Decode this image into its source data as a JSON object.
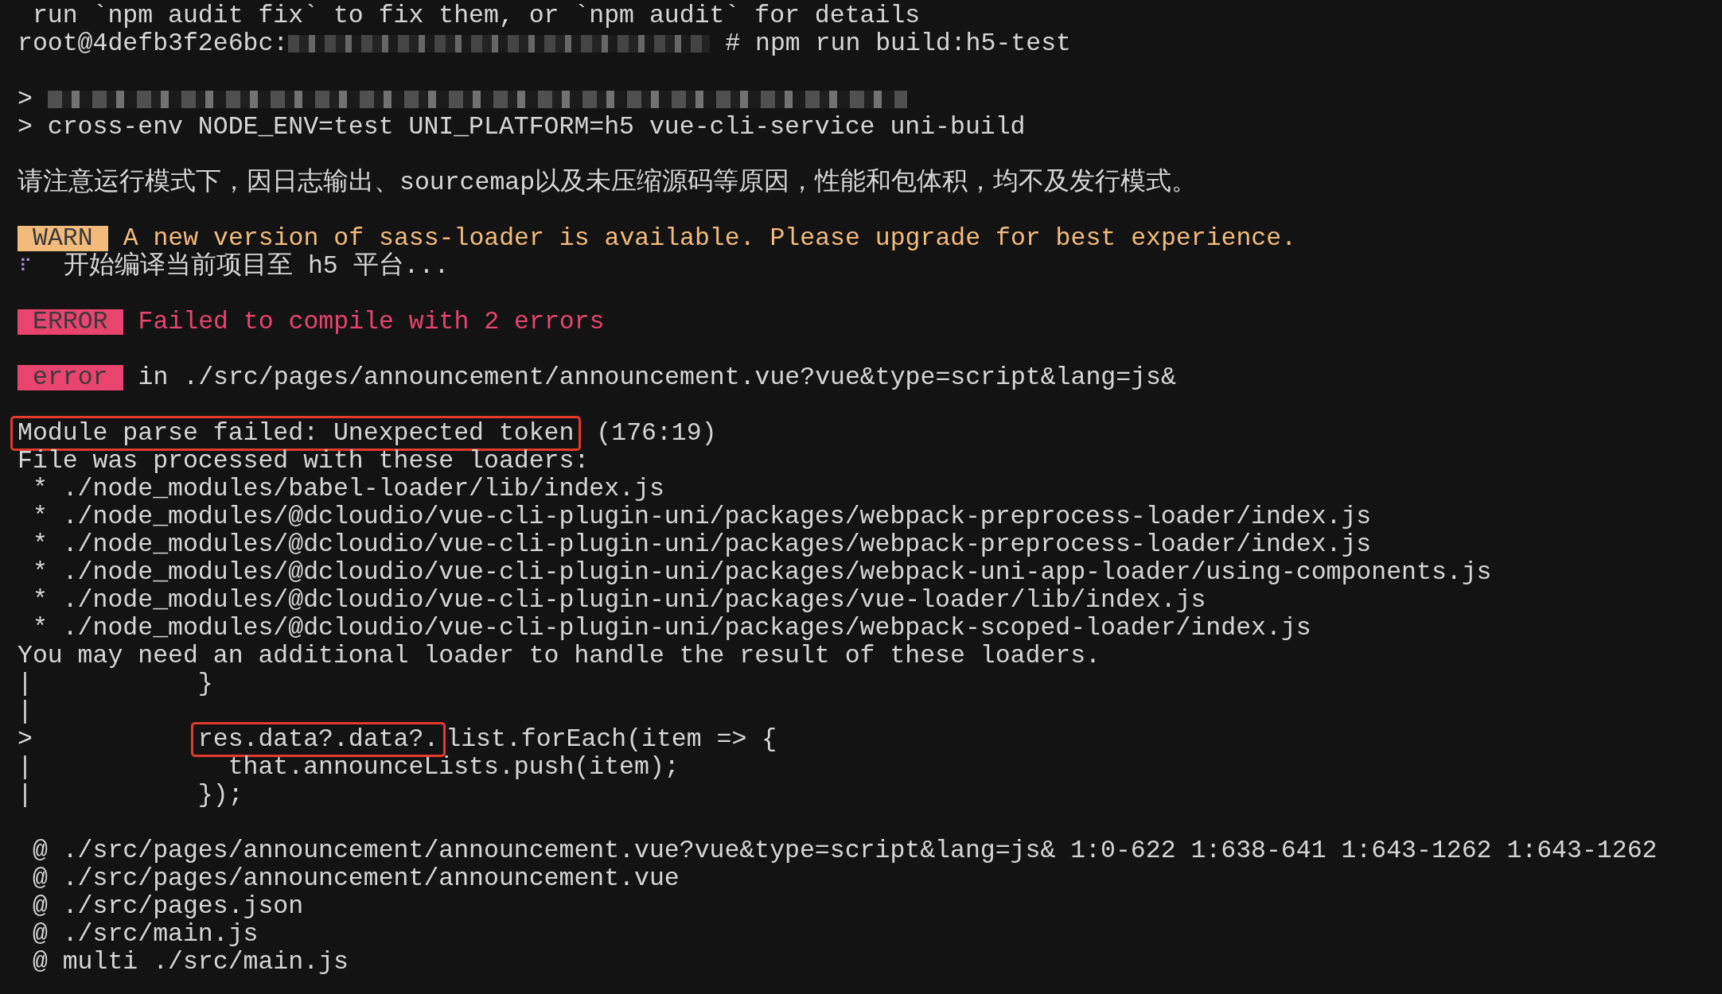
{
  "terminal": {
    "lines": [
      {
        "kind": "text",
        "text": " run `npm audit fix` to fix them, or `npm audit` for details"
      },
      {
        "kind": "prompt",
        "user": "root@4defb3f2e6bc:",
        "command": "# npm run build:h5-test"
      },
      {
        "kind": "blank"
      },
      {
        "kind": "redacted",
        "prefix": "> "
      },
      {
        "kind": "text",
        "text": "> cross-env NODE_ENV=test UNI_PLATFORM=h5 vue-cli-service uni-build"
      },
      {
        "kind": "blank"
      },
      {
        "kind": "text",
        "text": "请注意运行模式下，因日志输出、sourcemap以及未压缩源码等原因，性能和包体积，均不及发行模式。"
      },
      {
        "kind": "blank"
      },
      {
        "kind": "badge",
        "badge": "WARN",
        "color": "#f3bb7b",
        "colored": true,
        "text": "A new version of sass-loader is available. Please upgrade for best experience."
      },
      {
        "kind": "spinner",
        "icon": "⠏",
        "text": "开始编译当前项目至 h5 平台..."
      },
      {
        "kind": "blank"
      },
      {
        "kind": "badge",
        "badge": "ERROR",
        "color": "#e8446f",
        "colored": true,
        "text": "Failed to compile with 2 errors"
      },
      {
        "kind": "blank"
      },
      {
        "kind": "badge",
        "badge": "error",
        "color": "#e8446f",
        "colored": false,
        "text": "in ./src/pages/announcement/announcement.vue?vue&type=script&lang=js&"
      },
      {
        "kind": "blank"
      },
      {
        "kind": "highlight",
        "highlighted": "Module parse failed: Unexpected token",
        "rest": " (176:19)"
      },
      {
        "kind": "text",
        "text": "File was processed with these loaders:"
      },
      {
        "kind": "text",
        "text": " * ./node_modules/babel-loader/lib/index.js"
      },
      {
        "kind": "text",
        "text": " * ./node_modules/@dcloudio/vue-cli-plugin-uni/packages/webpack-preprocess-loader/index.js"
      },
      {
        "kind": "text",
        "text": " * ./node_modules/@dcloudio/vue-cli-plugin-uni/packages/webpack-preprocess-loader/index.js"
      },
      {
        "kind": "text",
        "text": " * ./node_modules/@dcloudio/vue-cli-plugin-uni/packages/webpack-uni-app-loader/using-components.js"
      },
      {
        "kind": "text",
        "text": " * ./node_modules/@dcloudio/vue-cli-plugin-uni/packages/vue-loader/lib/index.js"
      },
      {
        "kind": "text",
        "text": " * ./node_modules/@dcloudio/vue-cli-plugin-uni/packages/webpack-scoped-loader/index.js"
      },
      {
        "kind": "text",
        "text": "You may need an additional loader to handle the result of these loaders."
      },
      {
        "kind": "text",
        "text": "|           }"
      },
      {
        "kind": "text",
        "text": "|"
      },
      {
        "kind": "highlight",
        "prefix": ">           ",
        "highlighted": "res.data?.data?.",
        "rest": "list.forEach(item => {"
      },
      {
        "kind": "text",
        "text": "|             that.announceLists.push(item);"
      },
      {
        "kind": "text",
        "text": "|           });"
      },
      {
        "kind": "blank"
      },
      {
        "kind": "text",
        "text": " @ ./src/pages/announcement/announcement.vue?vue&type=script&lang=js& 1:0-622 1:638-641 1:643-1262 1:643-1262"
      },
      {
        "kind": "text",
        "text": " @ ./src/pages/announcement/announcement.vue"
      },
      {
        "kind": "text",
        "text": " @ ./src/pages.json"
      },
      {
        "kind": "text",
        "text": " @ ./src/main.js"
      },
      {
        "kind": "text",
        "text": " @ multi ./src/main.js"
      }
    ]
  }
}
